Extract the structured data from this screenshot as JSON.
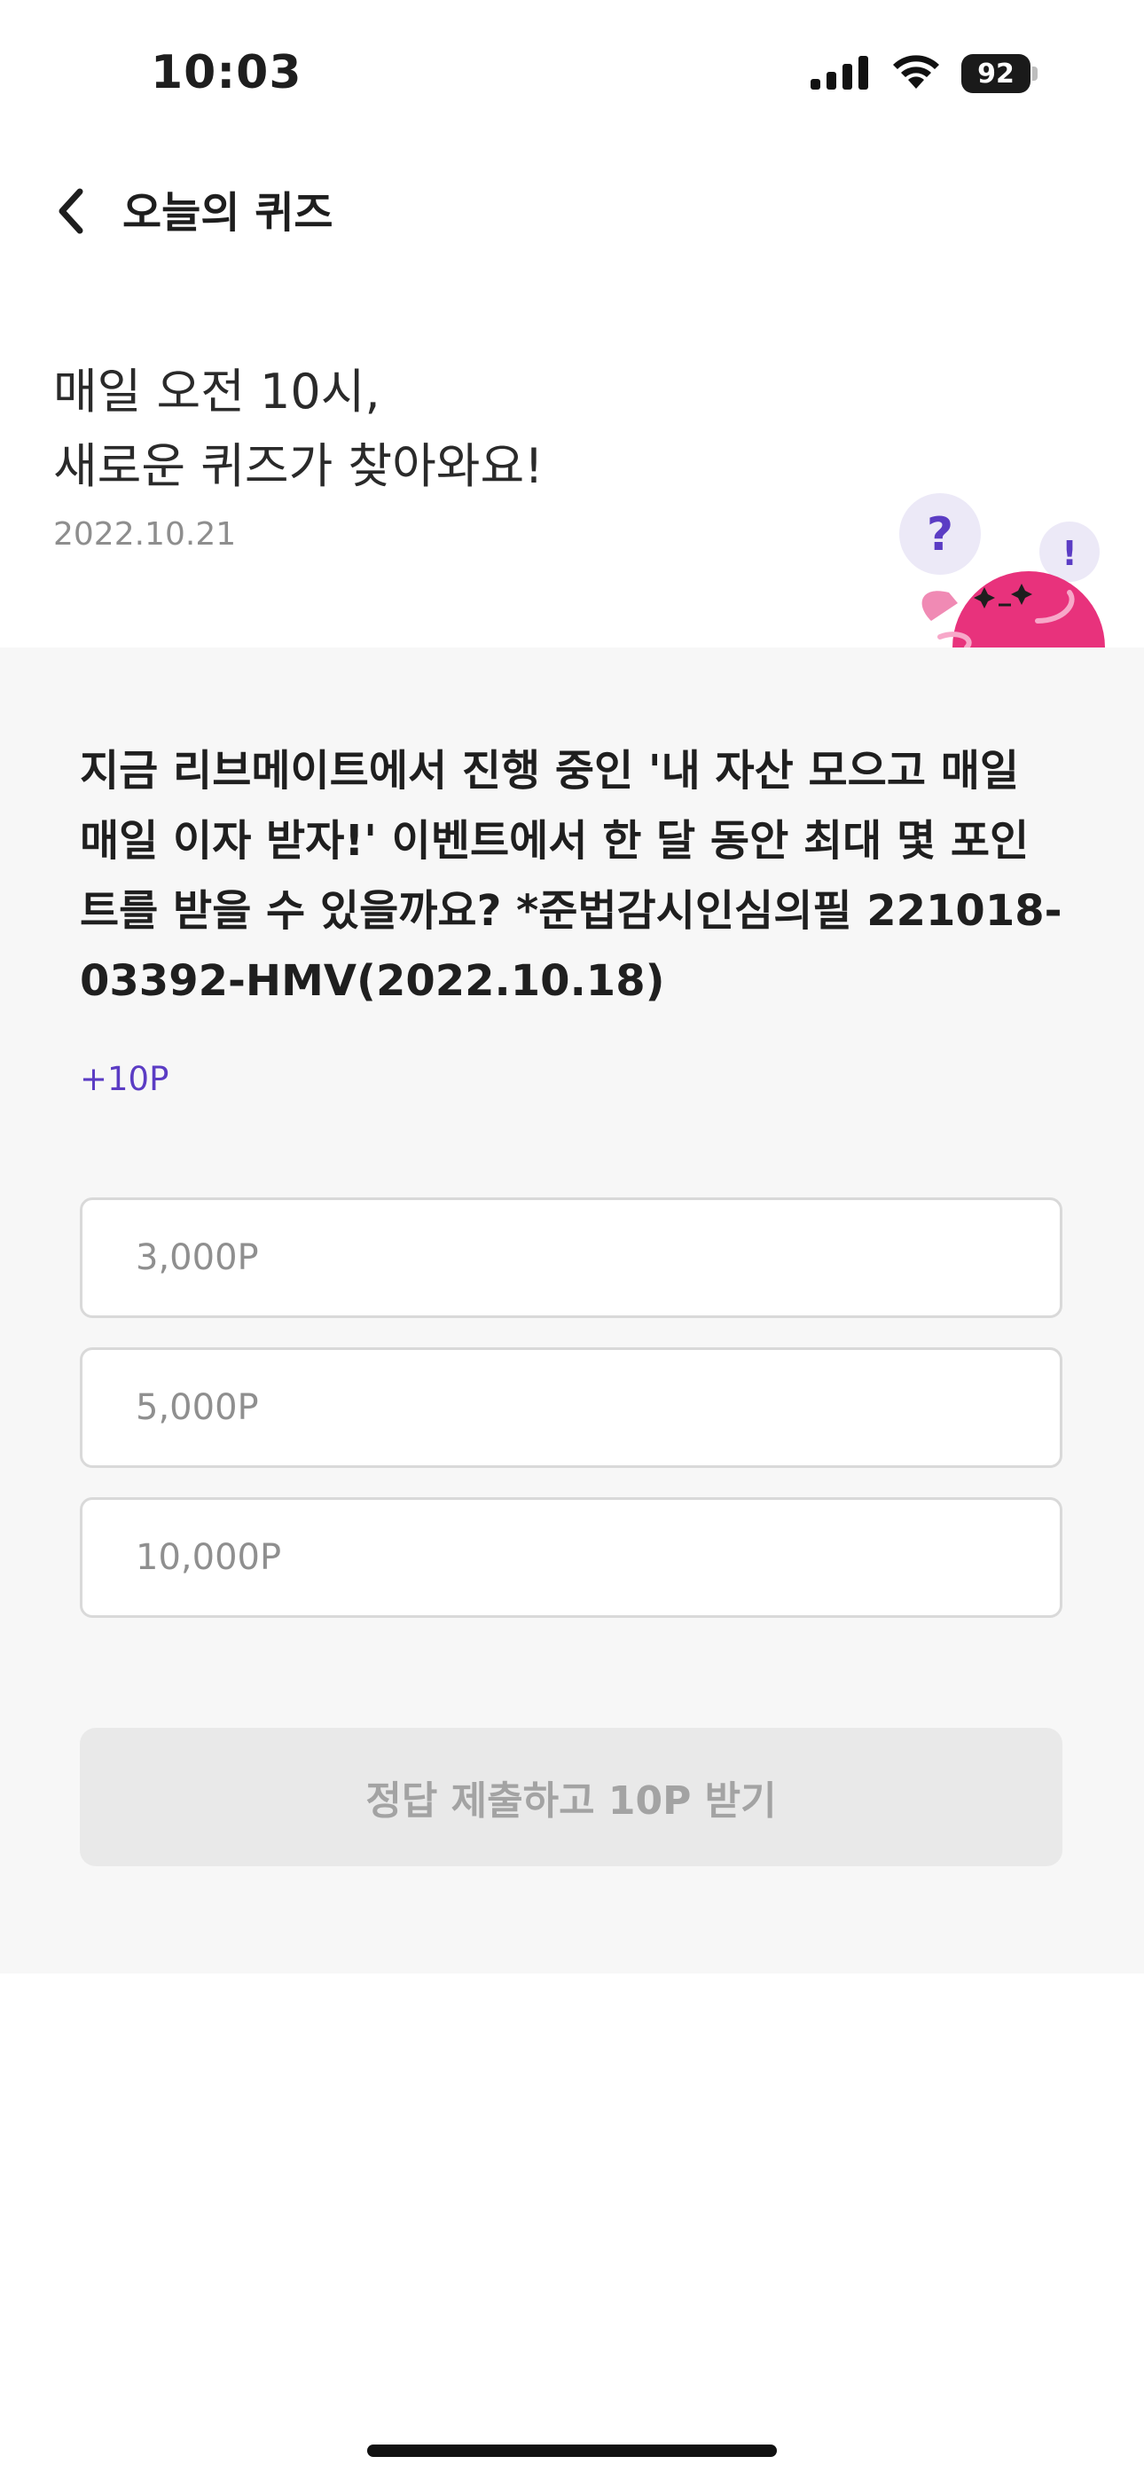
{
  "status_bar": {
    "time": "10:03",
    "battery": "92",
    "signal_icon": "cellular-signal-icon",
    "wifi_icon": "wifi-icon"
  },
  "nav": {
    "back_icon": "chevron-left-icon",
    "title": "오늘의 퀴즈"
  },
  "hero": {
    "line1": "매일 오전 10시,",
    "line2": "새로운 퀴즈가 찾아와요!",
    "date": "2022.10.21",
    "mascot_icon": "quiz-mascot-icon"
  },
  "quiz": {
    "question": "지금 리브메이트에서 진행 중인 '내 자산 모으고 매일 매일 이자 받자!' 이벤트에서 한 달 동안 최대 몇 포인트를 받을 수 있을까요? *준법감시인심의필 221018-03392-HMV(2022.10.18)",
    "reward": "+10P",
    "options": [
      "3,000P",
      "5,000P",
      "10,000P"
    ],
    "submit_label": "정답 제출하고 10P 받기"
  },
  "colors": {
    "accent": "#5b3cc4",
    "mascot_pink": "#e8327c",
    "panel_bg": "#f7f7f7",
    "button_disabled_bg": "#e9e9e9"
  }
}
